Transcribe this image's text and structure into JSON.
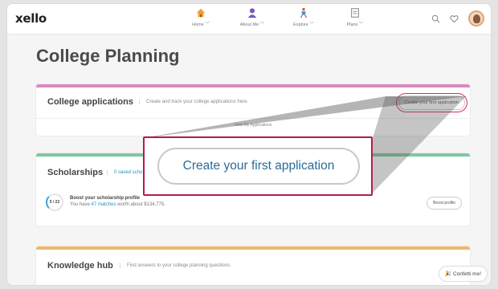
{
  "brand": {
    "logo": "xello"
  },
  "nav": {
    "items": [
      {
        "label": "Home",
        "icon": "home-icon"
      },
      {
        "label": "About Me",
        "icon": "person-icon"
      },
      {
        "label": "Explore",
        "icon": "explore-icon"
      },
      {
        "label": "Plans",
        "icon": "plans-icon"
      }
    ],
    "right_icons": [
      "search-icon",
      "heart-icon",
      "avatar"
    ]
  },
  "page": {
    "title": "College Planning"
  },
  "applications": {
    "title": "College applications",
    "subtitle": "Create and track your college applications here.",
    "create_button": "Create your first application",
    "view_link": "View My Applications",
    "accent": "#d88ac0"
  },
  "scholarships": {
    "title": "Scholarships",
    "subtitle_partial": "0 saved scho",
    "score": "5 / 22",
    "boost_title": "Boost your scholarship profile",
    "boost_prefix": "You have ",
    "boost_matches": "47 matches",
    "boost_suffix": " worth about $134,775.",
    "boost_button": "Boost profile",
    "accent": "#7ec8a0"
  },
  "knowledge": {
    "title": "Knowledge hub",
    "subtitle": "Find answers to your college planning questions.",
    "accent": "#f0b86a"
  },
  "confetti": {
    "label": "Confetti me!",
    "icon": "party-icon"
  },
  "zoom": {
    "label": "Create your first application",
    "highlight_color": "#b71c4a"
  }
}
